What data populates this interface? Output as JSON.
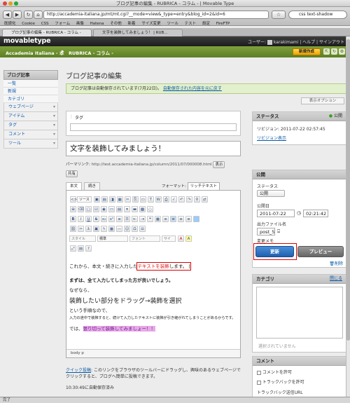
{
  "browser": {
    "window_title": "ブログ記事の編集 - RUBRICA - コラム - | Movable Type",
    "url": "http://accademia-italiana.jp/mt/mt.cgi?__mode=view&_type=entry&blog_id=2&id=6",
    "search_text": "css text-shadow",
    "bookmarks": [
      "既読化",
      "Cookie",
      "CSS",
      "フォーム",
      "画像",
      "Hatena",
      "その他",
      "新着",
      "サイズ変更",
      "ツール",
      "テスト",
      "設定",
      "FireFTP"
    ],
    "tabs": [
      "ブログ記事の編集 - RUBRICA - コラム -",
      "文字を装飾してみましょう！ | RUB..."
    ]
  },
  "mt_header": {
    "logo": "movabletype",
    "user_label": "ユーザー:",
    "username": "karakimami",
    "help": "ヘルプ",
    "signout": "サインアウト",
    "blog_name": "Accademia Italiana - 本",
    "site_name": "RUBRICA - コラム -",
    "new_button": "新規作成"
  },
  "sidebar": {
    "heading": "ブログ記事",
    "items": [
      "一覧",
      "新規",
      "カテゴリ"
    ],
    "menus": [
      "ウェブページ",
      "アイテム",
      "タグ",
      "コメント",
      "ツール"
    ]
  },
  "main": {
    "page_title": "ブログ記事の編集",
    "notice_text": "ブログ記事は自動保存されています(7月22日)。",
    "notice_link": "自動保存された内容を元に戻す",
    "display_options": "表示オプション",
    "tag_label": "タグ",
    "entry_title": "文字を装飾してみましょう！",
    "permalink_label": "パーマリンク:",
    "permalink_url": "http://test.accademia-italiana.jp/column/2011/07/000008.html",
    "view_button": "表示",
    "share_button": "共有",
    "tab_body": "本文",
    "tab_more": "続き",
    "format_label": "フォーマット:",
    "format_value": "リッチテキスト",
    "toolbar_source": "ソース",
    "style_select": "スタイル",
    "heading_select": "標準",
    "font_select": "フォント",
    "size_select": "サイ",
    "content": {
      "line1_a": "これから、本文・続きに入力した",
      "line1_red": "テキストを装飾",
      "line1_b": "します。",
      "line2": "まずは、全て入力してしまった方が良いでしょう。",
      "line3": "なぜなら、",
      "line4": "装飾したい部分をドラッグ→装飾を選択",
      "line5": "という手順なので、",
      "line6": "入力の途中で装飾すると、続けて入力したテキストに装飾が引き継がれてしまうことがあるからです。",
      "line7_a": "では、",
      "line7_hl": "張り切って装飾してみましょー！！"
    },
    "editor_status": "body  p",
    "quickpost_link": "クイック投稿",
    "quickpost_text": ": このリンクをブラウザのツールバーにドラッグし、興味のあるウェブページでクリックすると、ブログへ簡単に投稿できます。",
    "autosave_status": "10:30:49に自動保存済み"
  },
  "status_panel": {
    "heading": "ステータス",
    "state": "公開",
    "revision": "リビジョン: 2011-07-22 02:57:45",
    "revision_link": "リビジョン表示"
  },
  "publish_panel": {
    "heading": "公開",
    "status_label": "ステータス",
    "status_value": "公開",
    "date_label": "公開日",
    "date_value": "2011-07-22",
    "time_value": "02:21:42",
    "filename_label": "出力ファイル名",
    "filename_value": "post_5",
    "memo_label": "変更メモ",
    "update_button": "更新",
    "preview_button": "プレビュー",
    "delete_link": "削除"
  },
  "category_panel": {
    "heading": "カテゴリ",
    "close_link": "閉じる",
    "none_selected": "選択されていません"
  },
  "comment_panel": {
    "heading": "コメント",
    "allow_comments": "コメントを許可",
    "allow_trackbacks": "トラックバックを許可",
    "trackback_url": "トラックバック送信URL"
  },
  "statusbar": "完了",
  "colors": {
    "brand_green": "#6b8e2b",
    "update_blue": "#2d6fc2",
    "highlight_red": "#d00000",
    "link_blue": "#0a59a8"
  }
}
